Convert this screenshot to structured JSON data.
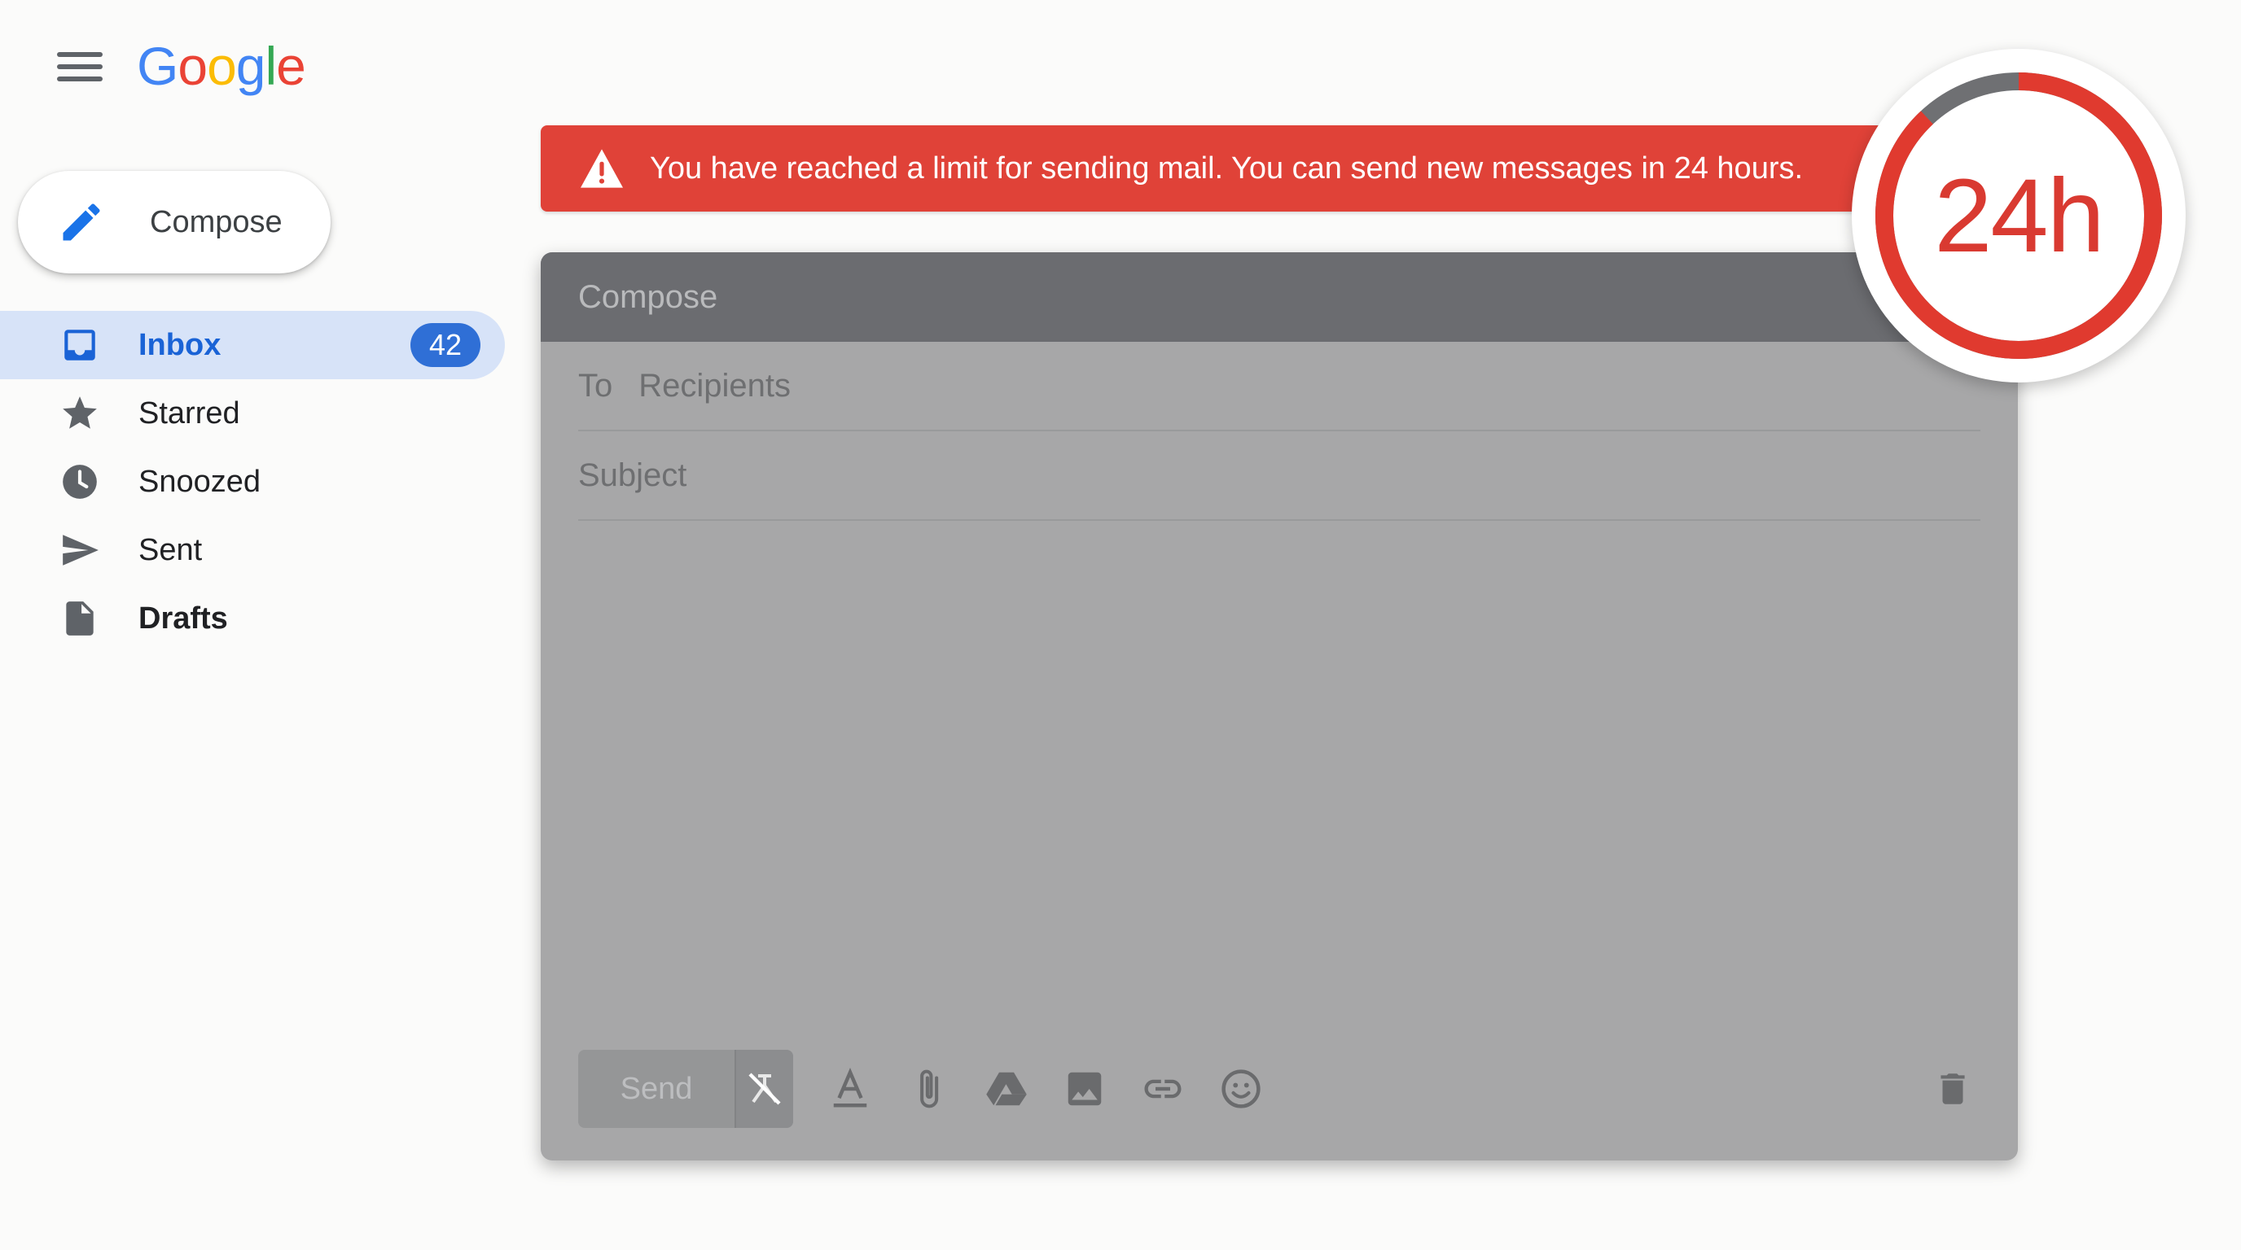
{
  "app": {
    "logo_text": "Google",
    "menu_icon": "hamburger-menu-icon"
  },
  "sidebar": {
    "compose_label": "Compose",
    "compose_icon": "pencil-icon",
    "items": [
      {
        "label": "Inbox",
        "icon": "inbox-icon",
        "badge": "42",
        "active": true
      },
      {
        "label": "Starred",
        "icon": "star-icon"
      },
      {
        "label": "Snoozed",
        "icon": "clock-icon"
      },
      {
        "label": "Sent",
        "icon": "send-icon"
      },
      {
        "label": "Drafts",
        "icon": "draft-icon",
        "bold": true
      }
    ]
  },
  "banner": {
    "icon": "warning-icon",
    "message": "You have reached a limit for sending mail. You can send new messages in 24 hours.",
    "color": "#e04238"
  },
  "compose_window": {
    "title": "Compose",
    "to_label": "To",
    "to_placeholder": "Recipients",
    "subject_placeholder": "Subject",
    "send_label": "Send",
    "toolbar_icons": [
      "schedule-send-disabled-icon",
      "text-format-icon",
      "attach-icon",
      "drive-icon",
      "image-icon",
      "link-icon",
      "emoji-icon",
      "trash-icon"
    ]
  },
  "timer": {
    "label": "24h",
    "accent_color": "#e03a2f",
    "remaining_fraction": 0.88
  }
}
